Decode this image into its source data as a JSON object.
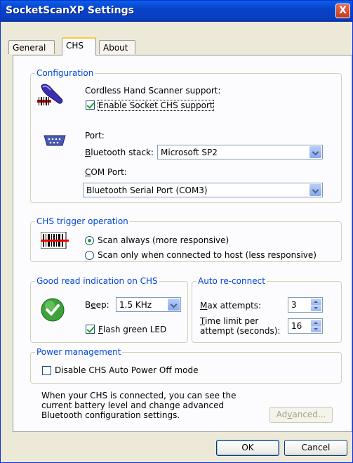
{
  "window": {
    "title": "SocketScanXP Settings",
    "close_glyph": "X"
  },
  "tabs": [
    {
      "label": "General",
      "active": false
    },
    {
      "label": "CHS",
      "active": true
    },
    {
      "label": "About",
      "active": false
    }
  ],
  "configuration": {
    "group_label": "Configuration",
    "scanner_support_label": "Cordless Hand Scanner support:",
    "enable_checkbox": {
      "label": "Enable Socket CHS support",
      "checked": true
    },
    "port_label": "Port:",
    "bt_stack_label": "Bluetooth stack:",
    "bt_stack_value": "Microsoft SP2",
    "com_port_label": "COM Port:",
    "com_port_value": "Bluetooth Serial Port (COM3)"
  },
  "trigger": {
    "group_label": "CHS trigger operation",
    "options": [
      {
        "label": "Scan always (more responsive)",
        "selected": true
      },
      {
        "label": "Scan only when connected to host (less responsive)",
        "selected": false
      }
    ]
  },
  "good_read": {
    "group_label": "Good read indication on CHS",
    "beep_label": "Beep:",
    "beep_value": "1.5 KHz",
    "flash_checkbox": {
      "label": "Flash green LED",
      "checked": true
    }
  },
  "reconnect": {
    "group_label": "Auto re-connect",
    "max_attempts_label": "Max attempts:",
    "max_attempts_value": "3",
    "time_limit_label_1": "Time limit per",
    "time_limit_label_2": "attempt (seconds):",
    "time_limit_value": "16"
  },
  "power": {
    "group_label": "Power management",
    "disable_checkbox": {
      "label": "Disable CHS Auto Power Off mode",
      "checked": false
    }
  },
  "info_text": {
    "line1": "When your CHS is connected, you can see the",
    "line2": "current battery level  and change advanced",
    "line3": "Bluetooth configuration settings."
  },
  "buttons": {
    "advanced": "Advanced...",
    "ok": "OK",
    "cancel": "Cancel"
  },
  "colors": {
    "title_bar": "#0a4fd6",
    "group_label": "#0046d5",
    "check_green": "#21a121"
  }
}
